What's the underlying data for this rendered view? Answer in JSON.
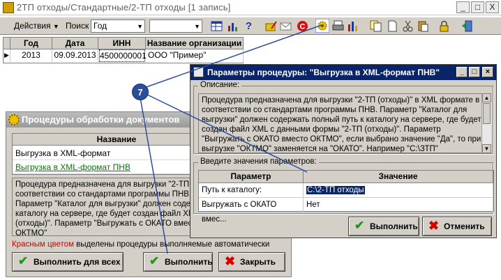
{
  "main_window": {
    "title": "2ТП отходы/Стандартные/2-ТП отходы [1 запись]",
    "controls": [
      "_",
      "□",
      "X"
    ]
  },
  "toolbar": {
    "actions_label": "Действия",
    "search_label": "Поиск",
    "search_field_value": "Год",
    "search_value": ""
  },
  "records_grid": {
    "columns": [
      "Год",
      "Дата",
      "ИНН",
      "Название организации"
    ],
    "rows": [
      {
        "year": "2013",
        "date": "09.09.2013",
        "inn": "4500000001",
        "name": "ООО \"Пример\""
      }
    ]
  },
  "procedures_window": {
    "title": "Процедуры обработки документов",
    "column_header": "Название",
    "items": [
      {
        "label": "Выгрузка в XML-формат",
        "color": "#000000"
      },
      {
        "label": "Выгрузка в XML-формат ПНВ",
        "color": "#007a00"
      }
    ],
    "description": "Процедура предназначена для выгрузки \"2-ТП (от соответствии со стандартами программы ПНВ. Параметр \"Каталог для выгрузки\" должен содер каталогу на сервере, где будет создан файл XML (отходы)\". Параметр \"Выгружать с ОКАТО вместо ОКТМО\"",
    "note_red": "Красным цветом",
    "note_rest": " выделены процедуры выполняемые автоматически",
    "buttons": {
      "run_all": "Выполнить для всех",
      "run": "Выполнить",
      "close": "Закрыть"
    }
  },
  "params_dialog": {
    "title": "Параметры процедуры: \"Выгрузка в XML-формат ПНВ\"",
    "description_label": "Описание:",
    "description": "Процедура предназначена для выгрузки \"2-ТП (отходы)\" в XML формате в соответствии со стандартами программы ПНВ. Параметр \"Каталог для выгрузки\" должен содержать полный путь к каталогу на сервере, где будет создан файл XML с данными формы \"2-ТП (отходы)\". Параметр \"Выгружать с ОКАТО вместо ОКТМО\", если выбрано значение \"Да\", то при выгрузке \"ОКТМО\" заменяется на \"ОКАТО\". Например \"C:\\ЗТП\"",
    "params_label": "Введите значения параметров:",
    "param_header": "Параметр",
    "value_header": "Значение",
    "params": [
      {
        "name": "Путь к каталогу:",
        "value": "C:\\2-ТП отходы"
      },
      {
        "name": "Выгружать с ОКАТО вмес...",
        "value": "Нет"
      }
    ],
    "buttons": {
      "run": "Выполнить",
      "cancel": "Отменить"
    }
  },
  "callout": {
    "number": "7",
    "color": "#2a4d9c"
  }
}
